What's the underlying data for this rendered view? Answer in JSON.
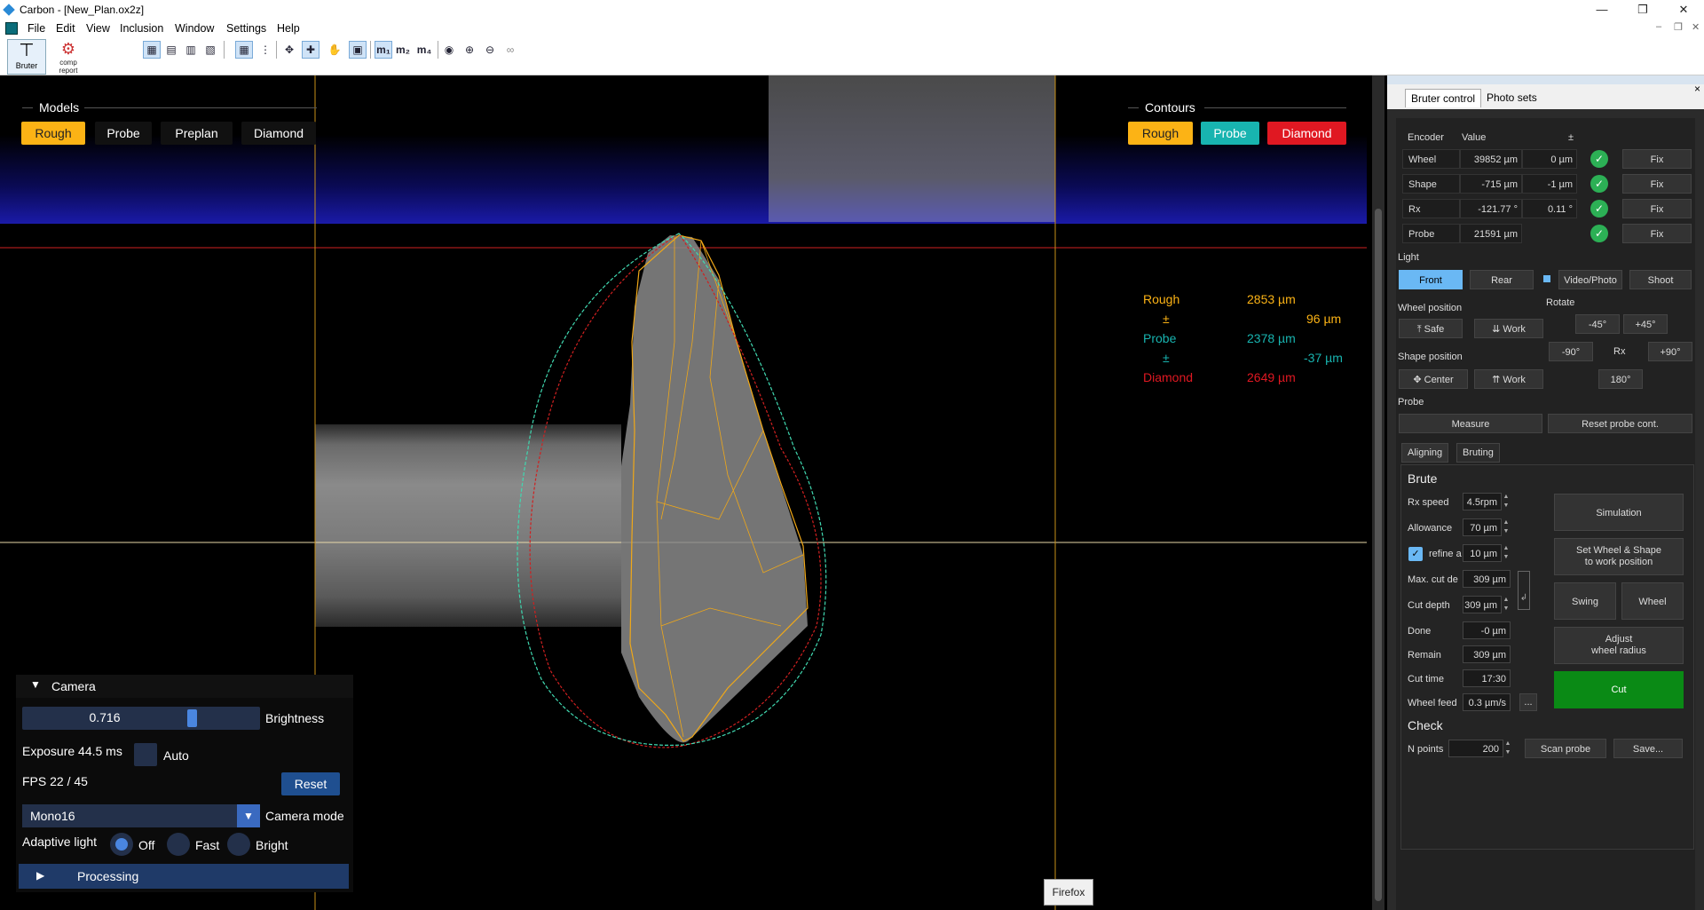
{
  "window": {
    "title": "Carbon - [New_Plan.ox2z]"
  },
  "menu": [
    "File",
    "Edit",
    "View",
    "Inclusion",
    "Window",
    "Settings",
    "Help"
  ],
  "toolbar": {
    "bruter_label": "Bruter",
    "report_label": "comp report"
  },
  "viewport": {
    "models_title": "Models",
    "models": [
      "Rough",
      "Probe",
      "Preplan",
      "Diamond"
    ],
    "contours_title": "Contours",
    "contours": [
      "Rough",
      "Probe",
      "Diamond"
    ],
    "measurements": [
      {
        "label": "Rough",
        "value": "2853 µm",
        "color": "#fcb315"
      },
      {
        "label": "±",
        "value": "96 µm",
        "color": "#fcb315"
      },
      {
        "label": "Probe",
        "value": "2378 µm",
        "color": "#18b4b0"
      },
      {
        "label": "±",
        "value": "-37 µm",
        "color": "#18b4b0"
      },
      {
        "label": "Diamond",
        "value": "2649 µm",
        "color": "#e01822"
      }
    ]
  },
  "camera": {
    "title": "Camera",
    "brightness_value": "0.716",
    "brightness_label": "Brightness",
    "exposure": "Exposure 44.5 ms",
    "auto_label": "Auto",
    "fps": "FPS  22 /  45",
    "reset_label": "Reset",
    "mode_value": "Mono16",
    "mode_label": "Camera mode",
    "adaptive_label": "Adaptive light",
    "adaptive_options": [
      "Off",
      "Fast",
      "Bright"
    ],
    "processing_label": "Processing"
  },
  "tooltip": "Firefox",
  "sidebar": {
    "tabs": [
      "Bruter control",
      "Photo sets"
    ],
    "close": "×",
    "encoder_headers": [
      "Encoder",
      "Value",
      "±"
    ],
    "encoders": [
      {
        "name": "Wheel",
        "value": "39852 µm",
        "delta": "0 µm",
        "fix": "Fix"
      },
      {
        "name": "Shape",
        "value": "-715 µm",
        "delta": "-1 µm",
        "fix": "Fix"
      },
      {
        "name": "Rx",
        "value": "-121.77 °",
        "delta": "0.11 °",
        "fix": "Fix"
      },
      {
        "name": "Probe",
        "value": "21591 µm",
        "delta": "",
        "fix": "Fix"
      }
    ],
    "light_label": "Light",
    "light_front": "Front",
    "light_rear": "Rear",
    "video_photo": "Video/Photo",
    "shoot": "Shoot",
    "rotate_label": "Rotate",
    "rotate": {
      "m45": "-45°",
      "p45": "+45°",
      "m90": "-90°",
      "rx": "Rx",
      "p90": "+90°",
      "r180": "180°"
    },
    "wheel_position_label": "Wheel position",
    "wheel_safe": "Safe",
    "wheel_work": "Work",
    "shape_position_label": "Shape position",
    "shape_center": "Center",
    "shape_work": "Work",
    "probe_label": "Probe",
    "measure": "Measure",
    "reset_probe": "Reset probe cont.",
    "subtabs": [
      "Aligning",
      "Bruting"
    ],
    "brute_title": "Brute",
    "fields": [
      {
        "label": "Rx speed",
        "value": "4.5rpm"
      },
      {
        "label": "Allowance",
        "value": "70 µm"
      },
      {
        "label": "refine a",
        "value": "10 µm"
      },
      {
        "label": "Max. cut de",
        "value": "309 µm"
      },
      {
        "label": "Cut depth",
        "value": "309 µm"
      },
      {
        "label": "Done",
        "value": "-0 µm"
      },
      {
        "label": "Remain",
        "value": "309 µm"
      },
      {
        "label": "Cut time",
        "value": "17:30"
      },
      {
        "label": "Wheel feed",
        "value": "0.3 µm/s"
      }
    ],
    "more": "...",
    "simulation": "Simulation",
    "set_wheel_shape": "Set Wheel & Shape\nto work position",
    "swing": "Swing",
    "wheel": "Wheel",
    "adjust_radius": "Adjust\nwheel radius",
    "cut": "Cut",
    "check_title": "Check",
    "npoints_label": "N points",
    "npoints_value": "200",
    "scan_probe": "Scan probe",
    "save": "Save..."
  }
}
